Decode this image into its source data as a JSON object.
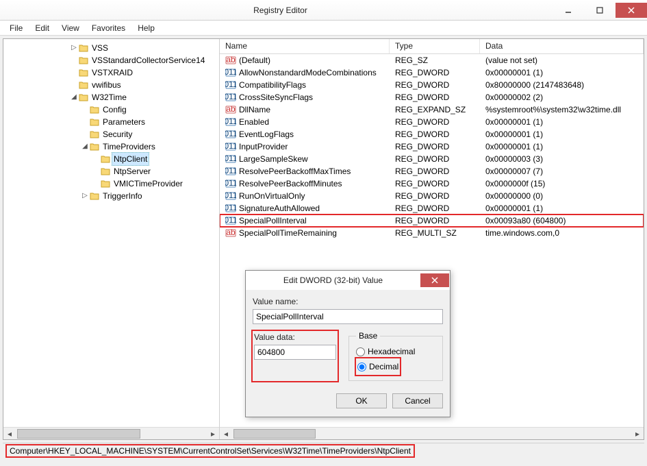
{
  "window": {
    "title": "Registry Editor"
  },
  "menu": {
    "file": "File",
    "edit": "Edit",
    "view": "View",
    "favorites": "Favorites",
    "help": "Help"
  },
  "tree": {
    "items": [
      {
        "indent": 6,
        "exp": "▷",
        "label": "VSS"
      },
      {
        "indent": 6,
        "exp": "",
        "label": "VSStandardCollectorService14"
      },
      {
        "indent": 6,
        "exp": "",
        "label": "VSTXRAID"
      },
      {
        "indent": 6,
        "exp": "",
        "label": "vwifibus"
      },
      {
        "indent": 6,
        "exp": "◢",
        "label": "W32Time"
      },
      {
        "indent": 7,
        "exp": "",
        "label": "Config"
      },
      {
        "indent": 7,
        "exp": "",
        "label": "Parameters"
      },
      {
        "indent": 7,
        "exp": "",
        "label": "Security"
      },
      {
        "indent": 7,
        "exp": "◢",
        "label": "TimeProviders"
      },
      {
        "indent": 8,
        "exp": "",
        "label": "NtpClient",
        "selected": true
      },
      {
        "indent": 8,
        "exp": "",
        "label": "NtpServer"
      },
      {
        "indent": 8,
        "exp": "",
        "label": "VMICTimeProvider"
      },
      {
        "indent": 7,
        "exp": "▷",
        "label": "TriggerInfo"
      }
    ]
  },
  "columns": {
    "name": "Name",
    "type": "Type",
    "data": "Data"
  },
  "values": [
    {
      "kind": "sz",
      "name": "(Default)",
      "type": "REG_SZ",
      "data": "(value not set)"
    },
    {
      "kind": "dw",
      "name": "AllowNonstandardModeCombinations",
      "type": "REG_DWORD",
      "data": "0x00000001 (1)"
    },
    {
      "kind": "dw",
      "name": "CompatibilityFlags",
      "type": "REG_DWORD",
      "data": "0x80000000 (2147483648)"
    },
    {
      "kind": "dw",
      "name": "CrossSiteSyncFlags",
      "type": "REG_DWORD",
      "data": "0x00000002 (2)"
    },
    {
      "kind": "sz",
      "name": "DllName",
      "type": "REG_EXPAND_SZ",
      "data": "%systemroot%\\system32\\w32time.dll"
    },
    {
      "kind": "dw",
      "name": "Enabled",
      "type": "REG_DWORD",
      "data": "0x00000001 (1)"
    },
    {
      "kind": "dw",
      "name": "EventLogFlags",
      "type": "REG_DWORD",
      "data": "0x00000001 (1)"
    },
    {
      "kind": "dw",
      "name": "InputProvider",
      "type": "REG_DWORD",
      "data": "0x00000001 (1)"
    },
    {
      "kind": "dw",
      "name": "LargeSampleSkew",
      "type": "REG_DWORD",
      "data": "0x00000003 (3)"
    },
    {
      "kind": "dw",
      "name": "ResolvePeerBackoffMaxTimes",
      "type": "REG_DWORD",
      "data": "0x00000007 (7)"
    },
    {
      "kind": "dw",
      "name": "ResolvePeerBackoffMinutes",
      "type": "REG_DWORD",
      "data": "0x0000000f (15)"
    },
    {
      "kind": "dw",
      "name": "RunOnVirtualOnly",
      "type": "REG_DWORD",
      "data": "0x00000000 (0)"
    },
    {
      "kind": "dw",
      "name": "SignatureAuthAllowed",
      "type": "REG_DWORD",
      "data": "0x00000001 (1)"
    },
    {
      "kind": "dw",
      "name": "SpecialPollInterval",
      "type": "REG_DWORD",
      "data": "0x00093a80 (604800)",
      "highlight": true
    },
    {
      "kind": "sz",
      "name": "SpecialPollTimeRemaining",
      "type": "REG_MULTI_SZ",
      "data": "time.windows.com,0"
    }
  ],
  "dialog": {
    "title": "Edit DWORD (32-bit) Value",
    "valueNameLabel": "Value name:",
    "valueName": "SpecialPollInterval",
    "valueDataLabel": "Value data:",
    "valueData": "604800",
    "baseLabel": "Base",
    "hexLabel": "Hexadecimal",
    "decLabel": "Decimal",
    "ok": "OK",
    "cancel": "Cancel"
  },
  "status": {
    "path": "Computer\\HKEY_LOCAL_MACHINE\\SYSTEM\\CurrentControlSet\\Services\\W32Time\\TimeProviders\\NtpClient"
  }
}
